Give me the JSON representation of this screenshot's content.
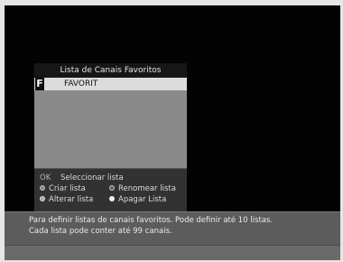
{
  "panel": {
    "title": "Lista de Canais Favoritos",
    "list_items": [
      {
        "tag": "F",
        "name": "FAVORIT",
        "selected": true
      }
    ]
  },
  "controls": {
    "ok_key": "OK",
    "ok_action": "Seleccionar lista",
    "create_list": "Criar lista",
    "rename_list": "Renomear lista",
    "alter_list": "Alterar lista",
    "delete_list": "Apagar Lista",
    "icons": [
      "red-dot-icon",
      "green-dot-icon",
      "yellow-dot-icon",
      "blue-dot-icon"
    ]
  },
  "info": {
    "line1": "Para definir listas de canais favoritos. Pode definir até 10 listas.",
    "line2": "Cada lista pode conter até 99 canais."
  },
  "colors": {
    "screen_bg": "#030303",
    "panel_bg": "#4a4a4a",
    "selected_row": "#dcdcdc",
    "info_bar": "#5c5c5c"
  }
}
